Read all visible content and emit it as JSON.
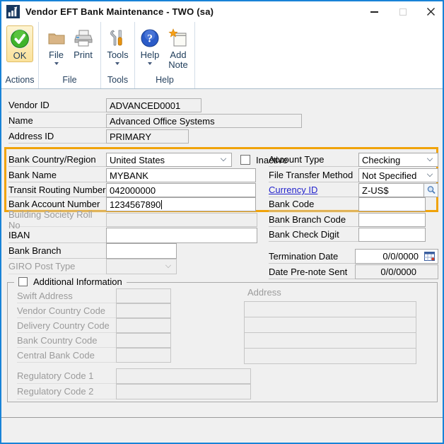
{
  "window": {
    "title": "Vendor EFT Bank Maintenance  -  TWO (sa)",
    "border_color": "#1883D7"
  },
  "toolbar": {
    "groups": [
      {
        "label": "Actions",
        "items": [
          {
            "label": "OK",
            "icon": "ok-check-icon",
            "highlighted": true
          }
        ]
      },
      {
        "label": "File",
        "items": [
          {
            "label": "File",
            "icon": "folder-icon",
            "dropdown": true
          },
          {
            "label": "Print",
            "icon": "printer-icon"
          }
        ]
      },
      {
        "label": "Tools",
        "items": [
          {
            "label": "Tools",
            "icon": "tools-icon",
            "dropdown": true
          }
        ]
      },
      {
        "label": "Help",
        "items": [
          {
            "label": "Help",
            "icon": "help-icon",
            "dropdown": true
          },
          {
            "label": "Add Note",
            "icon": "add-note-icon"
          }
        ]
      }
    ]
  },
  "fields": {
    "vendor_id": {
      "label": "Vendor ID",
      "value": "ADVANCED0001"
    },
    "name": {
      "label": "Name",
      "value": "Advanced Office Systems"
    },
    "address_id": {
      "label": "Address ID",
      "value": "PRIMARY"
    },
    "bank_country": {
      "label": "Bank Country/Region",
      "value": "United States"
    },
    "inactive": {
      "label": "Inactive",
      "checked": false
    },
    "bank_name": {
      "label": "Bank Name",
      "value": "MYBANK"
    },
    "transit_routing": {
      "label": "Transit Routing Number",
      "value": "042000000"
    },
    "bank_account": {
      "label": "Bank Account Number",
      "value": "1234567890"
    },
    "account_type": {
      "label": "Account Type",
      "value": "Checking"
    },
    "file_transfer_method": {
      "label": "File Transfer Method",
      "value": "Not Specified"
    },
    "currency_id": {
      "label": "Currency ID",
      "value": "Z-US$"
    },
    "bank_code": {
      "label": "Bank Code",
      "value": ""
    },
    "building_society": {
      "label": "Building Society Roll No",
      "value": ""
    },
    "iban": {
      "label": "IBAN",
      "value": ""
    },
    "bank_branch": {
      "label": "Bank Branch",
      "value": ""
    },
    "giro_post_type": {
      "label": "GIRO Post Type",
      "value": ""
    },
    "bank_branch_code": {
      "label": "Bank Branch Code",
      "value": ""
    },
    "bank_check_digit": {
      "label": "Bank Check Digit",
      "value": ""
    },
    "termination_date": {
      "label": "Termination Date",
      "value": "0/0/0000"
    },
    "date_prenote_sent": {
      "label": "Date Pre-note Sent",
      "value": "0/0/0000"
    },
    "additional_information": {
      "label": "Additional Information",
      "checked": false
    },
    "swift_address": {
      "label": "Swift Address",
      "value": ""
    },
    "vendor_country_code": {
      "label": "Vendor Country Code",
      "value": ""
    },
    "delivery_country_code": {
      "label": "Delivery Country Code",
      "value": ""
    },
    "bank_country_code": {
      "label": "Bank Country Code",
      "value": ""
    },
    "central_bank_code": {
      "label": "Central Bank Code",
      "value": ""
    },
    "address": {
      "label": "Address",
      "lines": [
        "",
        "",
        "",
        ""
      ]
    },
    "regulatory_code_1": {
      "label": "Regulatory Code 1",
      "value": ""
    },
    "regulatory_code_2": {
      "label": "Regulatory Code 2",
      "value": ""
    }
  },
  "colors": {
    "highlight_border": "#F0A30A",
    "window_border": "#1883D7",
    "link": "#2323CC"
  }
}
